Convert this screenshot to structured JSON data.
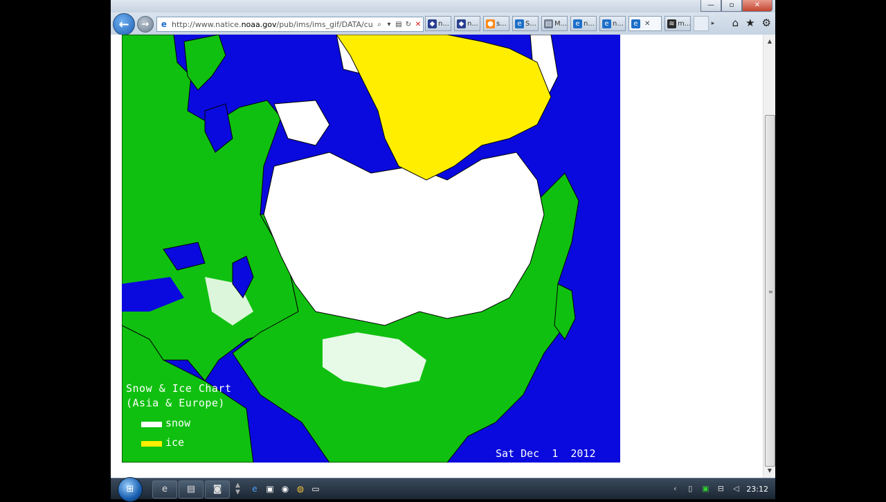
{
  "browser": {
    "address": {
      "url_prefix": "http://www.natice.",
      "url_domain": "noaa.gov",
      "url_suffix": "/pub/ims/ims_gif/DATA/cu"
    },
    "window_controls": {
      "minimize": "—",
      "maximize": "▫",
      "close": "✕"
    },
    "tabs": [
      {
        "label": "n...",
        "icon": "noaa-icon",
        "color": "#2a3f8f"
      },
      {
        "label": "n...",
        "icon": "noaa-icon",
        "color": "#2a3f8f"
      },
      {
        "label": "s...",
        "icon": "orange-feed-icon",
        "color": "#ff8a1a"
      },
      {
        "label": "S...",
        "icon": "ie-icon",
        "color": "#1e6fc8"
      },
      {
        "label": "M...",
        "icon": "page-icon",
        "color": "#6a7a8e"
      },
      {
        "label": "n...",
        "icon": "ie-icon",
        "color": "#1e6fc8"
      },
      {
        "label": "n...",
        "icon": "ie-icon",
        "color": "#1e6fc8"
      },
      {
        "label": "",
        "icon": "ie-icon",
        "color": "#1e6fc8",
        "active": true,
        "close": "✕"
      },
      {
        "label": "m...",
        "icon": "striped-icon",
        "color": "#2b2b2b"
      }
    ],
    "right_controls": [
      "home-icon",
      "favorites-star-icon",
      "tools-gear-icon"
    ]
  },
  "map": {
    "title_line1": "Snow & Ice Chart",
    "title_line2": "(Asia & Europe)",
    "legend": [
      {
        "label": "snow",
        "color": "#ffffff"
      },
      {
        "label": "ice",
        "color": "#ffff00"
      }
    ],
    "date": "Sat Dec  1  2012",
    "colors": {
      "water": "#0a0ade",
      "land": "#10c010",
      "snow": "#ffffff",
      "ice": "#ffee00"
    }
  },
  "taskbar": {
    "clock": "23:12"
  }
}
